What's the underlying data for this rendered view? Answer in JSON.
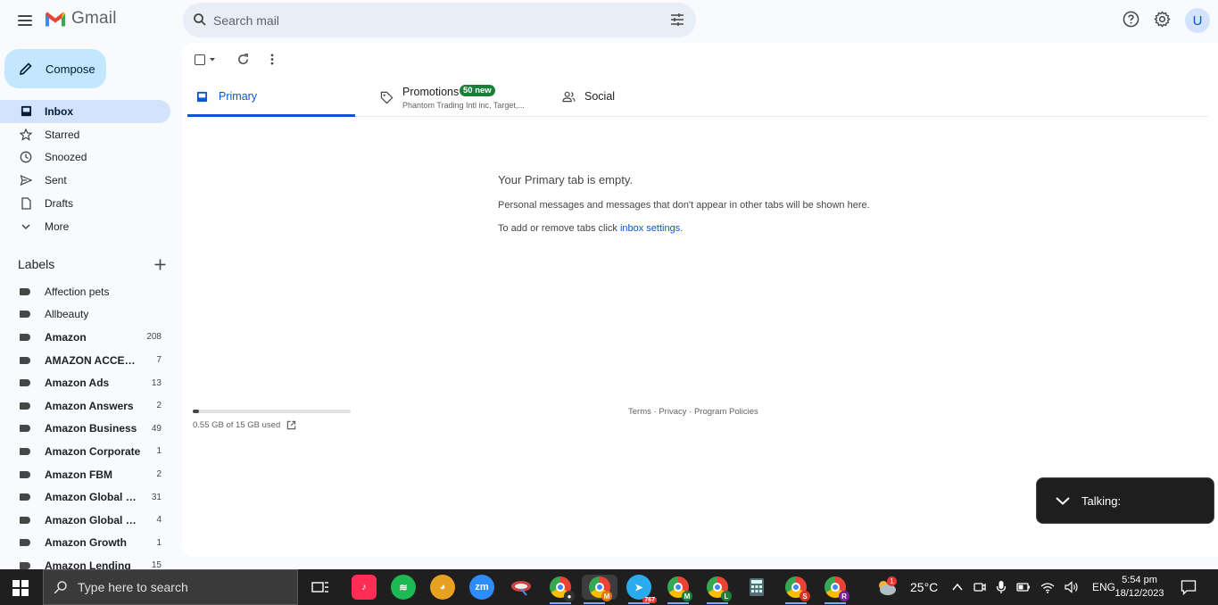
{
  "app": {
    "name": "Gmail"
  },
  "search": {
    "placeholder": "Search mail"
  },
  "compose": {
    "label": "Compose"
  },
  "nav": [
    {
      "label": "Inbox",
      "icon": "inbox-icon",
      "active": true
    },
    {
      "label": "Starred",
      "icon": "star-icon"
    },
    {
      "label": "Snoozed",
      "icon": "clock-icon"
    },
    {
      "label": "Sent",
      "icon": "send-icon"
    },
    {
      "label": "Drafts",
      "icon": "draft-icon"
    },
    {
      "label": "More",
      "icon": "chevron-down-icon"
    }
  ],
  "labels": {
    "heading": "Labels",
    "items": [
      {
        "name": "Affection pets",
        "count": ""
      },
      {
        "name": "Allbeauty",
        "count": ""
      },
      {
        "name": "Amazon",
        "count": "208"
      },
      {
        "name": "AMAZON ACCELER...",
        "count": "7"
      },
      {
        "name": "Amazon Ads",
        "count": "13"
      },
      {
        "name": "Amazon Answers",
        "count": "2"
      },
      {
        "name": "Amazon Business",
        "count": "49"
      },
      {
        "name": "Amazon Corporate",
        "count": "1"
      },
      {
        "name": "Amazon FBM",
        "count": "2"
      },
      {
        "name": "Amazon Global Lo...",
        "count": "31"
      },
      {
        "name": "Amazon Global Sell...",
        "count": "4"
      },
      {
        "name": "Amazon Growth",
        "count": "1"
      },
      {
        "name": "Amazon Lending",
        "count": "15"
      }
    ]
  },
  "tabs": {
    "primary": "Primary",
    "promotions": "Promotions",
    "promotions_badge": "50 new",
    "promotions_senders": "Phantom Trading Intl inc, Target,...",
    "social": "Social"
  },
  "empty_state": {
    "heading": "Your Primary tab is empty.",
    "line1": "Personal messages and messages that don't appear in other tabs will be shown here.",
    "line2_prefix": "To add or remove tabs click ",
    "line2_link": "inbox settings",
    "line2_suffix": "."
  },
  "storage": {
    "text": "0.55 GB of 15 GB used",
    "used_fraction": 0.037
  },
  "footer": {
    "terms": "Terms",
    "privacy": "Privacy",
    "policies": "Program Policies",
    "sep": " · "
  },
  "talking": {
    "label": "Talking:"
  },
  "avatar": {
    "initial": "U"
  },
  "taskbar": {
    "search_placeholder": "Type here to search",
    "weather": "25°C",
    "lang": "ENG",
    "time": "5:54 pm",
    "date": "18/12/2023",
    "telegram_badge": "767",
    "notif_badge": "1"
  },
  "colors": {
    "accent": "#0b57d0",
    "compose_bg": "#c2e7ff",
    "active_nav": "#d3e3fd",
    "badge_green": "#188038"
  }
}
